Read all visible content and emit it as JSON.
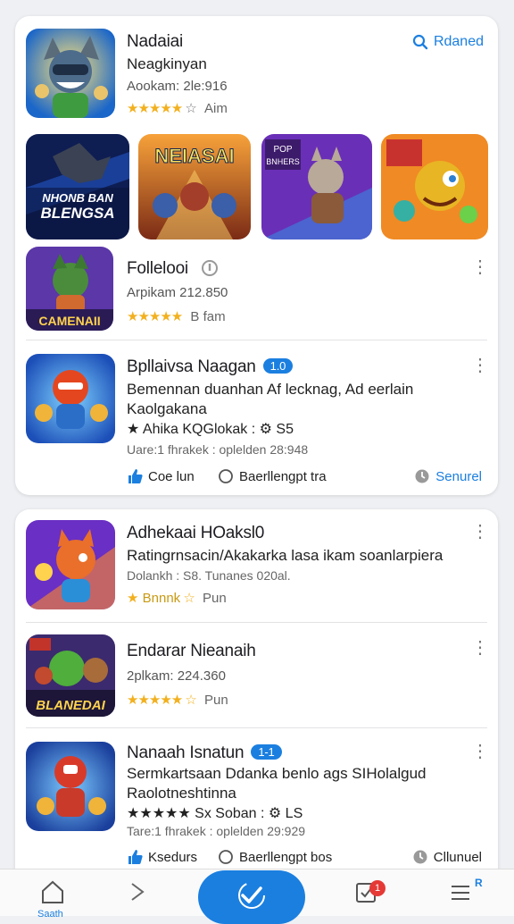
{
  "card1": {
    "search_link": "Rdaned",
    "featured": {
      "title": "Nadaiai",
      "subtitle": "Neagkinyan",
      "meta": "Aookam: 2le:916",
      "stars": "★★★★★",
      "rating_text": "Aim"
    },
    "banners": [
      {
        "text": "NHONB BAN BLENGSA"
      },
      {
        "text": "NEIASAI"
      },
      {
        "text": "POP BNHERS"
      },
      {
        "text": ""
      }
    ],
    "item1": {
      "title": "Follelooi",
      "meta": "Arpikam 212.850",
      "stars": "★★★★★",
      "rating_text": "B fam",
      "icon_text": "CAMENAII"
    },
    "item2": {
      "title": "Bpllaivsa Naagan",
      "badge": "1.0",
      "desc_line1": "Bemennan duanhan Af lecknag, Ad eerlain",
      "desc_line2": "Kaolgakana",
      "tag_line": "★ Ahika KQGlokak : ⚙ S5",
      "meta": "Uare:1 fhrakek : oplelden 28:948",
      "action_left": "Coe lun",
      "action_mid": "Baerllengpt tra",
      "action_right": "Senurel"
    }
  },
  "card2": {
    "item3": {
      "title": "Adhekaai HOaksl0",
      "desc": "Ratingrnsacin/Akakarka lasa ikam soanlarpiera",
      "meta": "Dolankh : S8. Tunanes 020al.",
      "stars": "★",
      "rating_text": "Bnnnk",
      "rating_text2": "Pun"
    },
    "item4": {
      "title": "Endarar Nieanaih",
      "meta": "2plkam: 224.360",
      "stars": "★★★★★",
      "rating_text": "Pun",
      "icon_text": "BLANEDAI"
    },
    "item5": {
      "title": "Nanaah Isnatun",
      "badge": "1-1",
      "desc_line1": "Sermkartsaan Ddanka benlo ags SIHolalgud",
      "desc_line2": "Raolotneshtinna",
      "tag_line": "★★★★★ Sx Soban : ⚙ LS",
      "meta": "Tare:1 fhrakek : oplelden 29:929",
      "action_left": "Ksedurs",
      "action_mid": "Baerllengpt bos",
      "action_right": "Cllunuel"
    }
  },
  "bottom_nav": {
    "home_label": "Saath",
    "badge_count": "1",
    "menu_badge": "R"
  },
  "colors": {
    "accent": "#1b7fe0",
    "star": "#f2b01e",
    "badge_red": "#e53935"
  }
}
